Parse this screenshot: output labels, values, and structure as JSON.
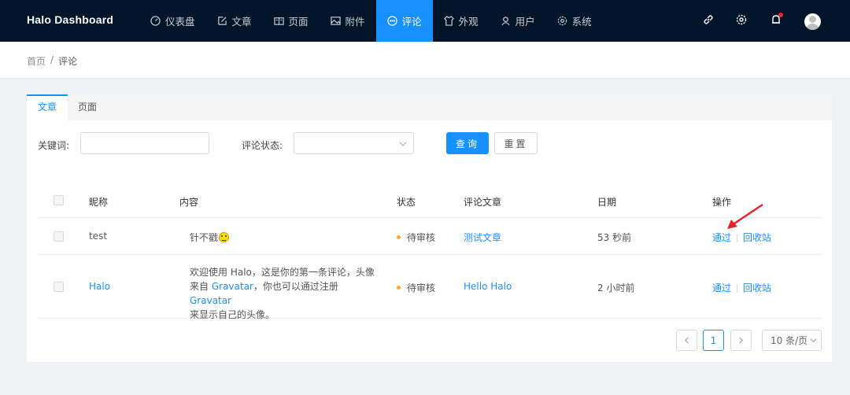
{
  "header": {
    "brand": "Halo  Dashboard",
    "nav": [
      {
        "label": "仪表盘",
        "icon": "dashboard-icon"
      },
      {
        "label": "文章",
        "icon": "edit-icon"
      },
      {
        "label": "页面",
        "icon": "book-icon"
      },
      {
        "label": "附件",
        "icon": "picture-icon"
      },
      {
        "label": "评论",
        "icon": "comment-icon",
        "active": true
      },
      {
        "label": "外观",
        "icon": "skin-icon"
      },
      {
        "label": "用户",
        "icon": "user-icon"
      },
      {
        "label": "系统",
        "icon": "setting-icon"
      }
    ],
    "right_icons": [
      "link-icon",
      "gear-icon",
      "bell-icon",
      "avatar"
    ]
  },
  "breadcrumb": {
    "home": "首页",
    "separator": "/",
    "current": "评论"
  },
  "tabs": [
    {
      "label": "文章",
      "active": true
    },
    {
      "label": "页面",
      "active": false
    }
  ],
  "filters": {
    "keyword_label": "关键词:",
    "keyword_value": "",
    "status_label": "评论状态:",
    "status_value": "",
    "search_button": "查询",
    "reset_button": "重置"
  },
  "table": {
    "columns": [
      "昵称",
      "内容",
      "状态",
      "评论文章",
      "日期",
      "操作"
    ],
    "rows": [
      {
        "nickname": "test",
        "content": "针不戳",
        "status": "待审核",
        "post": "测试文章",
        "date": "53 秒前",
        "actions": [
          "通过",
          "回收站"
        ]
      },
      {
        "nickname": "Halo",
        "content_parts": [
          "欢迎使用 Halo，这是你的第一条评论，头像",
          "来自 ",
          "Gravatar",
          "，你也可以通过注册 ",
          "Gravatar",
          "来显示自己的头像。"
        ],
        "status": "待审核",
        "post": "Hello Halo",
        "date": "2 小时前",
        "actions": [
          "通过",
          "回收站"
        ]
      }
    ]
  },
  "pagination": {
    "current_page": "1",
    "page_size": "10 条/页"
  },
  "colors": {
    "primary": "#1890ff",
    "header_bg": "#001529",
    "warning": "#faad14",
    "annotation_arrow": "#e8242b"
  }
}
